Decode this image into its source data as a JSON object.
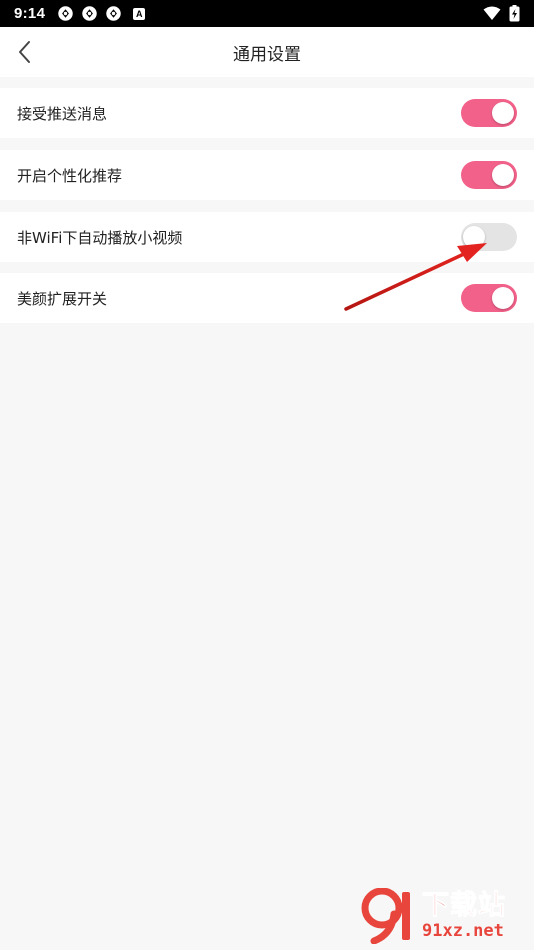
{
  "status_bar": {
    "time": "9:14",
    "left_icons": [
      "sync-icon",
      "sync-icon",
      "sync-icon",
      "a-badge-icon"
    ],
    "a_badge": "A",
    "right_icons": [
      "wifi-icon",
      "battery-icon"
    ]
  },
  "header": {
    "title": "通用设置",
    "back_icon": "chevron-left-icon"
  },
  "settings": [
    {
      "label": "接受推送消息",
      "enabled": true
    },
    {
      "label": "开启个性化推荐",
      "enabled": true
    },
    {
      "label": "非WiFi下自动播放小视频",
      "enabled": false
    },
    {
      "label": "美颜扩展开关",
      "enabled": true
    }
  ],
  "colors": {
    "toggle_on": "#f2618a",
    "toggle_off": "#e4e4e4",
    "annotation_arrow": "#d8201e",
    "page_background": "#f7f7f7"
  },
  "watermark": {
    "title": "下载站",
    "domain": "91xz.net",
    "logo_text": "9"
  }
}
